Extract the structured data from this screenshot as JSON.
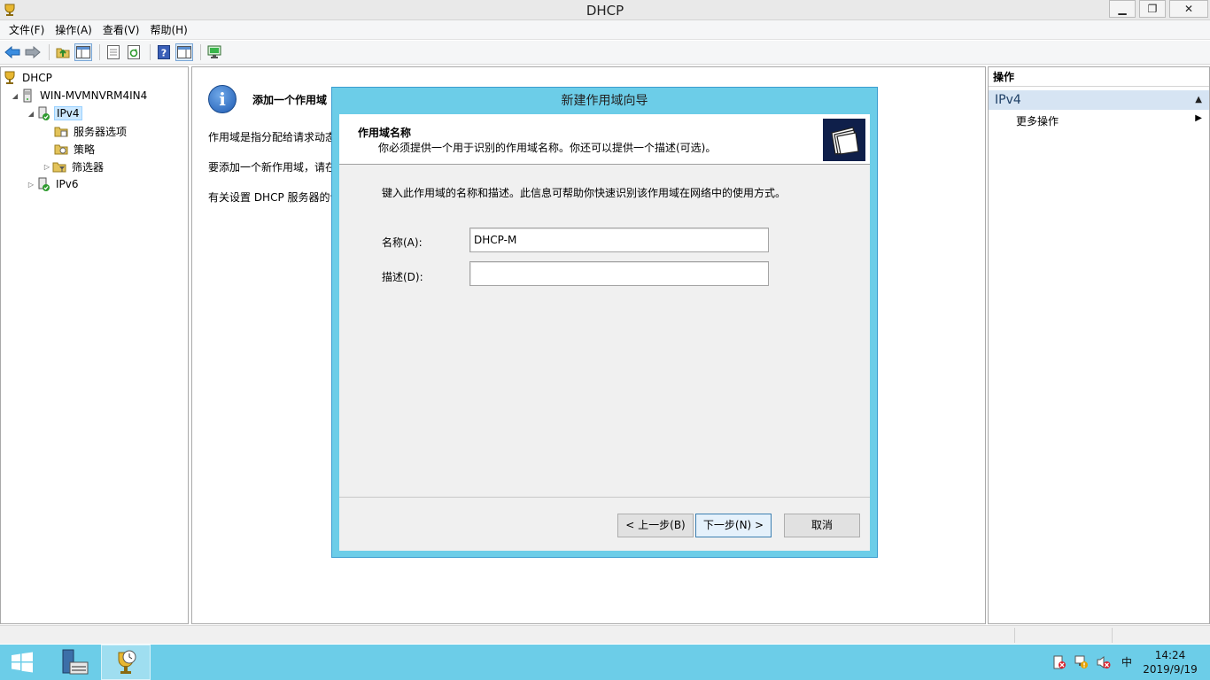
{
  "window": {
    "title": "DHCP"
  },
  "menu": {
    "items": [
      "文件(F)",
      "操作(A)",
      "查看(V)",
      "帮助(H)"
    ]
  },
  "tree": {
    "root": "DHCP",
    "server": "WIN-MVMNVRM4IN4",
    "ipv4": "IPv4",
    "server_options": "服务器选项",
    "policies": "策略",
    "filters": "筛选器",
    "ipv6": "IPv6"
  },
  "content": {
    "heading": "添加一个作用域",
    "line1": "作用域是指分配给请求动态",
    "line2": "要添加一个新作用域，请在",
    "line3": "有关设置 DHCP 服务器的详"
  },
  "actions": {
    "header": "操作",
    "section": "IPv4",
    "more": "更多操作"
  },
  "dialog": {
    "title": "新建作用域向导",
    "header_title": "作用域名称",
    "header_subtitle": "你必须提供一个用于识别的作用域名称。你还可以提供一个描述(可选)。",
    "description": "键入此作用域的名称和描述。此信息可帮助你快速识别该作用域在网络中的使用方式。",
    "name_label": "名称(A):",
    "name_value": "DHCP-M",
    "desc_label": "描述(D):",
    "desc_value": "",
    "back_button": "< 上一步(B)",
    "next_button": "下一步(N) >",
    "cancel_button": "取消"
  },
  "taskbar": {
    "ime": "中",
    "time": "14:24",
    "date": "2019/9/19"
  },
  "colors": {
    "accent": "#6ccde8",
    "selection": "#cce8ff",
    "action_section": "#d6e4f3"
  },
  "icons": [
    "app-icon",
    "back-icon",
    "forward-icon",
    "up-folder-icon",
    "show-tree-icon",
    "export-icon",
    "refresh-icon",
    "help-icon",
    "console-icon",
    "monitor-icon",
    "info-icon",
    "wizard-folders-icon",
    "windows-start-icon",
    "server-manager-icon",
    "dhcp-icon",
    "action-center-icon",
    "network-icon",
    "volume-icon"
  ]
}
